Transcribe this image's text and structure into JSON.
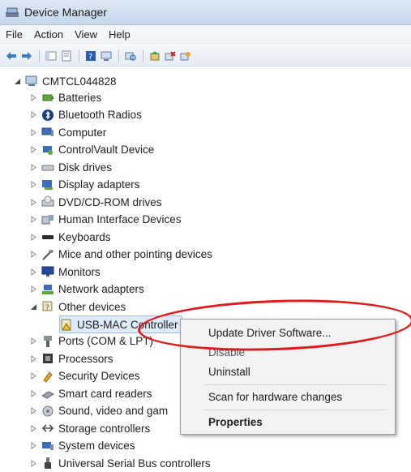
{
  "window": {
    "title": "Device Manager"
  },
  "menu": [
    "File",
    "Action",
    "View",
    "Help"
  ],
  "toolbar_icons": [
    "back-arrow-icon",
    "forward-arrow-icon",
    "console-tree-icon",
    "properties-icon",
    "help-icon",
    "display-icon",
    "scan-hardware-icon",
    "update-driver-icon",
    "uninstall-icon",
    "disable-icon"
  ],
  "tree": {
    "root": "CMTCL044828",
    "categories": [
      "Batteries",
      "Bluetooth Radios",
      "Computer",
      "ControlVault Device",
      "Disk drives",
      "Display adapters",
      "DVD/CD-ROM drives",
      "Human Interface Devices",
      "Keyboards",
      "Mice and other pointing devices",
      "Monitors",
      "Network adapters",
      "Other devices",
      "USB-MAC Controller",
      "Ports (COM & LPT)",
      "Processors",
      "Security Devices",
      "Smart card readers",
      "Sound, video and gam",
      "Storage controllers",
      "System devices",
      "Universal Serial Bus controllers"
    ]
  },
  "context_menu": {
    "update_driver": "Update Driver Software...",
    "disable": "Disable",
    "uninstall": "Uninstall",
    "scan": "Scan for hardware changes",
    "properties": "Properties"
  },
  "colors": {
    "highlight_ellipse": "#e01a1a",
    "title_bar": "#c6d8ee"
  }
}
